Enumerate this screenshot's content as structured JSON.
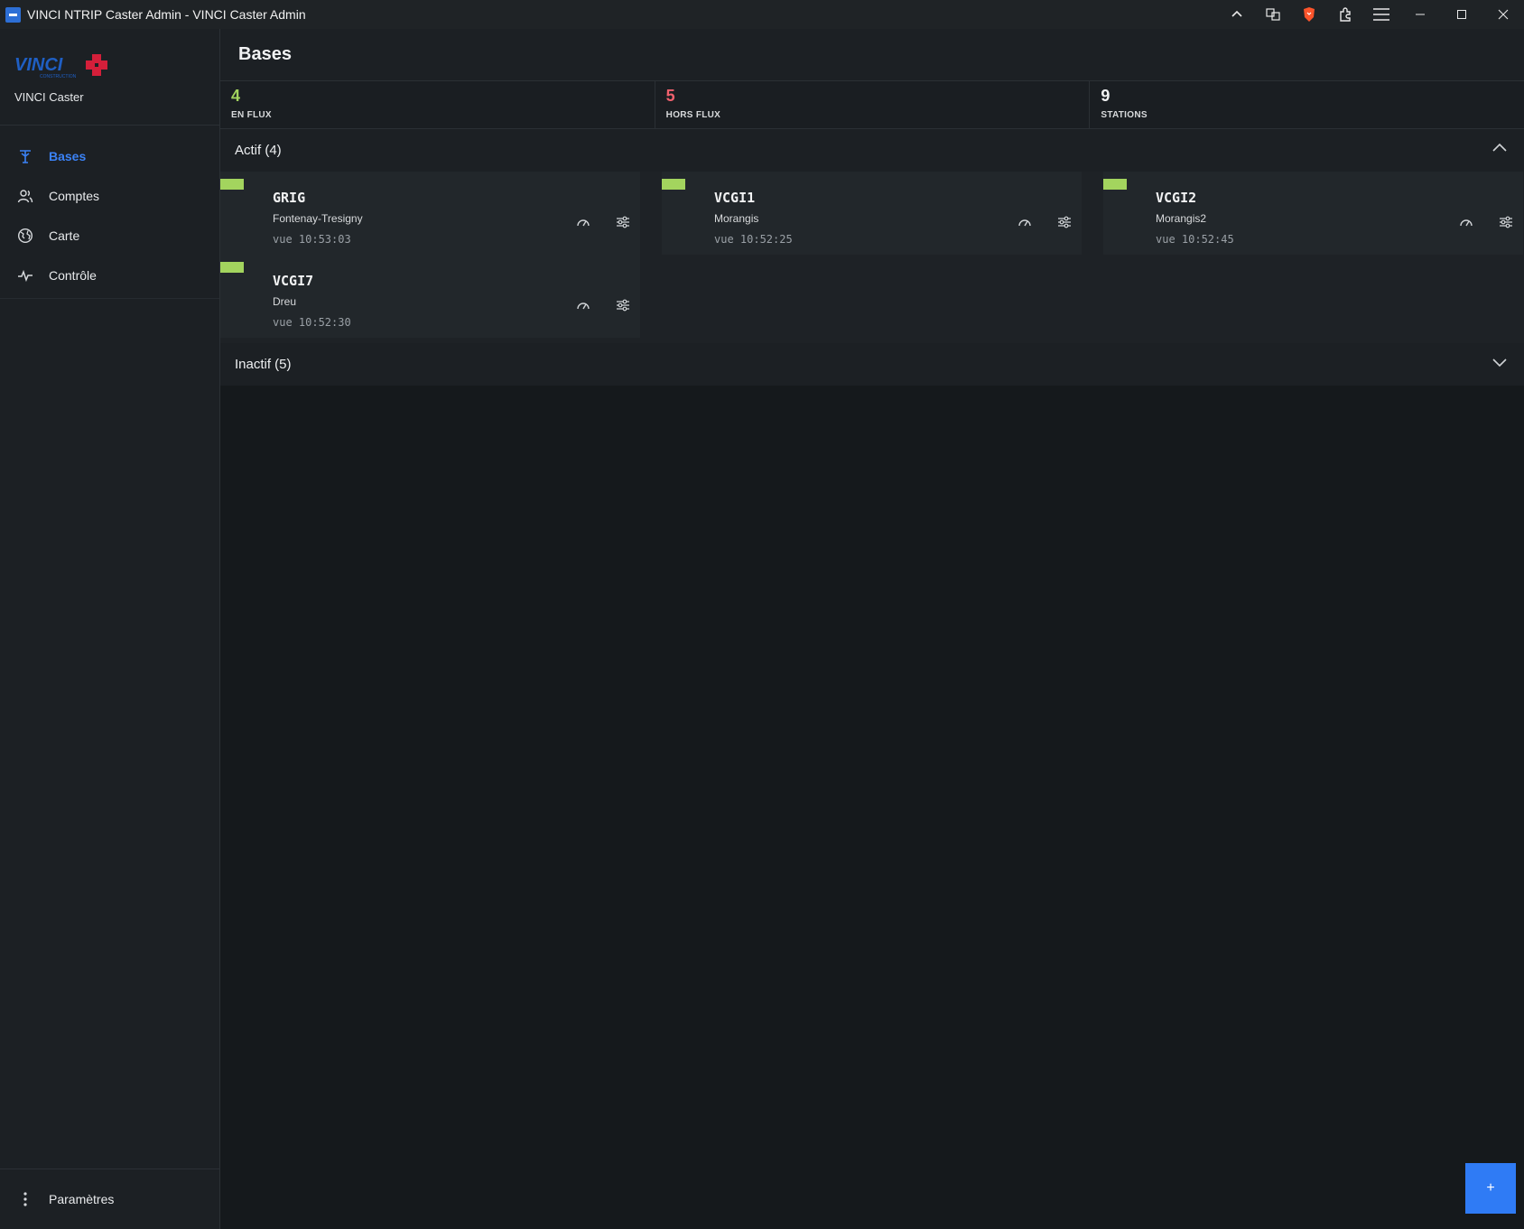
{
  "window": {
    "title": "VINCI NTRIP Caster Admin - VINCI Caster Admin"
  },
  "sidebar": {
    "brand_name": "VINCI Caster",
    "items": [
      {
        "label": "Bases",
        "icon": "antenna-icon",
        "active": true
      },
      {
        "label": "Comptes",
        "icon": "users-icon",
        "active": false
      },
      {
        "label": "Carte",
        "icon": "globe-icon",
        "active": false
      },
      {
        "label": "Contrôle",
        "icon": "activity-icon",
        "active": false
      }
    ],
    "settings_label": "Paramètres"
  },
  "header": {
    "title": "Bases"
  },
  "stats": [
    {
      "value": "4",
      "label": "EN FLUX",
      "color": "#a3d45e"
    },
    {
      "value": "5",
      "label": "HORS FLUX",
      "color": "#f0616d"
    },
    {
      "value": "9",
      "label": "STATIONS",
      "color": "#f2f3f4"
    }
  ],
  "groups": {
    "active": {
      "title": "Actif (4)",
      "expanded": true
    },
    "inactive": {
      "title": "Inactif (5)",
      "expanded": false
    }
  },
  "bases": [
    {
      "name": "GRIG",
      "location": "Fontenay-Tresigny",
      "seen": "vue 10:53:03",
      "status_color": "#a3d45e"
    },
    {
      "name": "VCGI1",
      "location": "Morangis",
      "seen": "vue 10:52:25",
      "status_color": "#a3d45e"
    },
    {
      "name": "VCGI2",
      "location": "Morangis2",
      "seen": "vue 10:52:45",
      "status_color": "#a3d45e"
    },
    {
      "name": "VCGI7",
      "location": "Dreu",
      "seen": "vue 10:52:30",
      "status_color": "#a3d45e"
    }
  ],
  "fab": {
    "label": "+"
  },
  "colors": {
    "accent": "#3b82f6",
    "online": "#a3d45e",
    "offline": "#f0616d"
  }
}
